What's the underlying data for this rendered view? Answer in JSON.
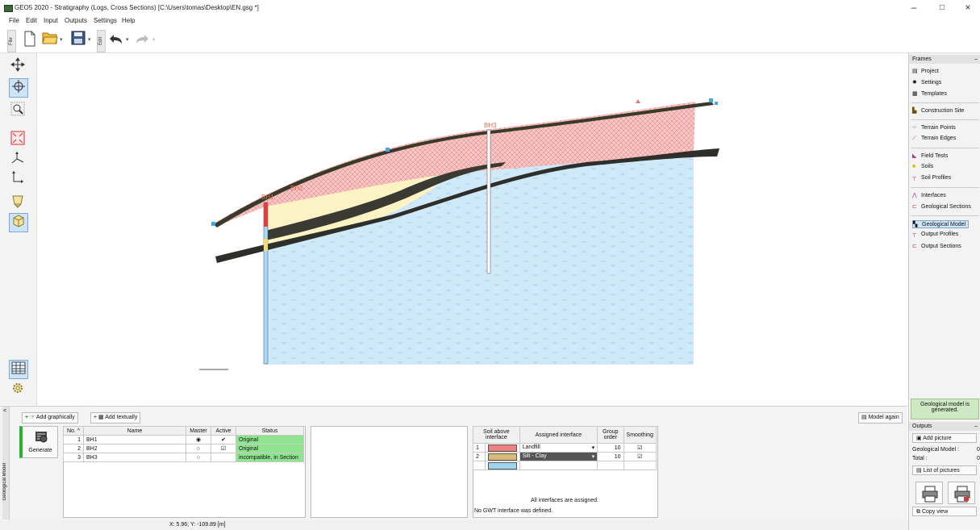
{
  "window": {
    "title": "GEO5 2020 - Stratigraphy (Logs, Cross Sections) [C:\\Users\\tomas\\Desktop\\EN.gsg *]",
    "minimize": "–",
    "maximize": "□",
    "close": "×"
  },
  "menu": [
    "File",
    "Edit",
    "Input",
    "Outputs",
    "Settings",
    "Help"
  ],
  "toolbar": {
    "file_tab": "File",
    "edit_tab": "Edit"
  },
  "canvas": {
    "borehole_labels": [
      "BH1",
      "BH2",
      "BH3"
    ]
  },
  "frames": {
    "title": "Frames",
    "collapse": "–",
    "groups": [
      [
        {
          "label": "Project",
          "icon": "project-icon"
        },
        {
          "label": "Settings",
          "icon": "settings-icon"
        },
        {
          "label": "Templates",
          "icon": "templates-icon"
        }
      ],
      [
        {
          "label": "Construction Site",
          "icon": "construction-site-icon"
        }
      ],
      [
        {
          "label": "Terrain Points",
          "icon": "terrain-points-icon"
        },
        {
          "label": "Terrain Edges",
          "icon": "terrain-edges-icon"
        }
      ],
      [
        {
          "label": "Field Tests",
          "icon": "field-tests-icon"
        },
        {
          "label": "Soils",
          "icon": "soils-icon"
        },
        {
          "label": "Soil Profiles",
          "icon": "soil-profiles-icon"
        }
      ],
      [
        {
          "label": "Interfaces",
          "icon": "interfaces-icon"
        },
        {
          "label": "Geological Sections",
          "icon": "geological-sections-icon"
        }
      ],
      [
        {
          "label": "Geological Model",
          "icon": "geological-model-icon",
          "selected": true
        },
        {
          "label": "Output Profiles",
          "icon": "output-profiles-icon"
        },
        {
          "label": "Output Sections",
          "icon": "output-sections-icon"
        }
      ]
    ]
  },
  "status_box": {
    "line1": "Geological model is",
    "line2": "generated."
  },
  "outputs": {
    "title": "Outputs",
    "collapse": "–",
    "add_picture": "Add picture",
    "geological_model_label": "Geological Model :",
    "geological_model_value": "0",
    "total_label": "Total :",
    "total_value": "0",
    "list_of_pictures": "List of pictures",
    "copy_view": "Copy view"
  },
  "bottom": {
    "side_label": "Geological Model",
    "collapse": "˂",
    "add_graphically": "Add graphically",
    "add_textually": "Add textually",
    "model_again": "Model again",
    "generate": "Generate",
    "boreholes": {
      "headers": [
        "No. ^",
        "Name",
        "Master",
        "Active",
        "Status"
      ],
      "rows": [
        {
          "no": "1",
          "name": "BH1",
          "master": "◉",
          "active": "✔",
          "status": "Original"
        },
        {
          "no": "2",
          "name": "BH2",
          "master": "○",
          "active": "☑",
          "status": "Original"
        },
        {
          "no": "3",
          "name": "BH3",
          "master": "○",
          "active": "",
          "status": "incompatible, in Section"
        }
      ]
    },
    "interfaces": {
      "headers": [
        "Soil above interface",
        "Assigned interface",
        "Group order",
        "Smoothing"
      ],
      "rows": [
        {
          "no": "1",
          "color": "#f08080",
          "assigned": "Landfill",
          "group": "10",
          "smooth": "☑"
        },
        {
          "no": "2",
          "color": "#d9b978",
          "assigned": "Silt - Clay",
          "group": "10",
          "smooth": "☑"
        }
      ],
      "gwt_color": "#9fd4ee",
      "all_assigned": "All interfaces are assigned.",
      "no_gwt": "No GWT interface was defined."
    }
  },
  "statusbar": {
    "coords": "X: 5.96; Y: -109.89 [m]"
  }
}
